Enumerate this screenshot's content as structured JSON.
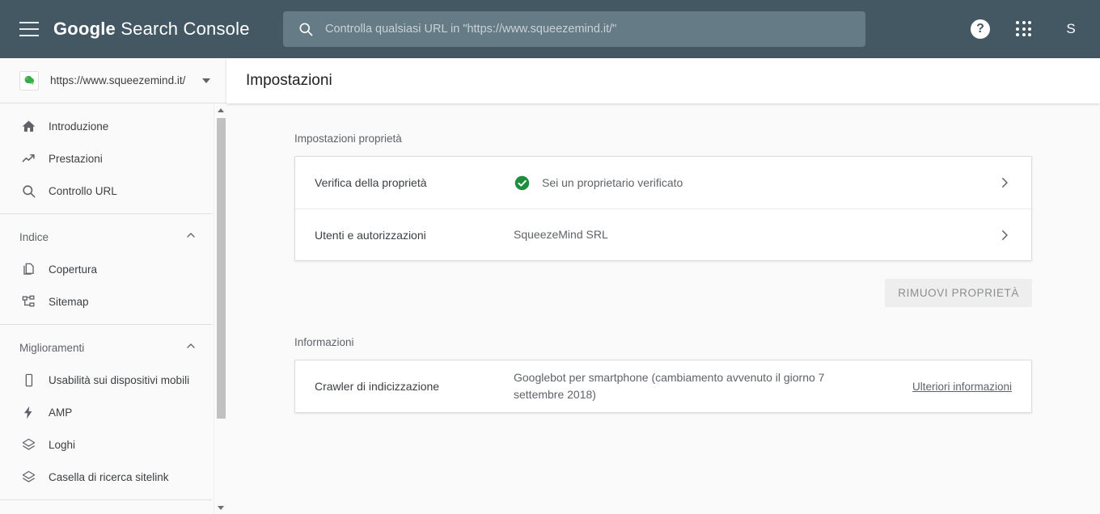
{
  "header": {
    "menu_icon": "hamburger-menu-icon",
    "brand_google": "Google",
    "brand_product": "Search Console",
    "search": {
      "icon": "search-icon",
      "placeholder": "Controlla qualsiasi URL in \"https://www.squeezemind.it/\"",
      "value": ""
    },
    "help_label": "?",
    "apps_icon": "apps-grid-icon",
    "avatar_initial": "S",
    "background_color": "#435862",
    "search_background_color": "#657b85"
  },
  "sidebar": {
    "property": {
      "favicon": "site-favicon",
      "url": "https://www.squeezemind.it/",
      "caret_icon": "chevron-down-icon"
    },
    "top_items": [
      {
        "label": "Introduzione",
        "icon": "home-icon"
      },
      {
        "label": "Prestazioni",
        "icon": "trending-up-icon"
      },
      {
        "label": "Controllo URL",
        "icon": "search-icon"
      }
    ],
    "sections": [
      {
        "label": "Indice",
        "collapse_icon": "chevron-up-icon",
        "items": [
          {
            "label": "Copertura",
            "icon": "pages-copy-icon"
          },
          {
            "label": "Sitemap",
            "icon": "account-tree-icon"
          }
        ]
      },
      {
        "label": "Miglioramenti",
        "collapse_icon": "chevron-up-icon",
        "items": [
          {
            "label": "Usabilità sui dispositivi mobili",
            "icon": "mobile-device-icon"
          },
          {
            "label": "AMP",
            "icon": "lightning-bolt-icon"
          },
          {
            "label": "Loghi",
            "icon": "layers-icon"
          },
          {
            "label": "Casella di ricerca sitelink",
            "icon": "layers-icon"
          }
        ]
      }
    ],
    "scrollbar": {
      "up_arrow_icon": "scroll-up-arrow-icon",
      "down_arrow_icon": "scroll-down-arrow-icon"
    }
  },
  "main": {
    "page_title": "Impostazioni",
    "property_settings": {
      "section_label": "Impostazioni proprietà",
      "rows": [
        {
          "label": "Verifica della proprietà",
          "value": "Sei un proprietario verificato",
          "status_icon": "verified-check-icon",
          "status_color": "#1e8e3e",
          "chevron_icon": "chevron-right-icon"
        },
        {
          "label": "Utenti e autorizzazioni",
          "value": "SqueezeMind SRL",
          "chevron_icon": "chevron-right-icon"
        }
      ],
      "remove_button": "RIMUOVI PROPRIETÀ"
    },
    "information": {
      "section_label": "Informazioni",
      "rows": [
        {
          "label": "Crawler di indicizzazione",
          "value": "Googlebot per smartphone (cambiamento avvenuto il giorno 7 settembre 2018)",
          "link": "Ulteriori informazioni"
        }
      ]
    }
  }
}
